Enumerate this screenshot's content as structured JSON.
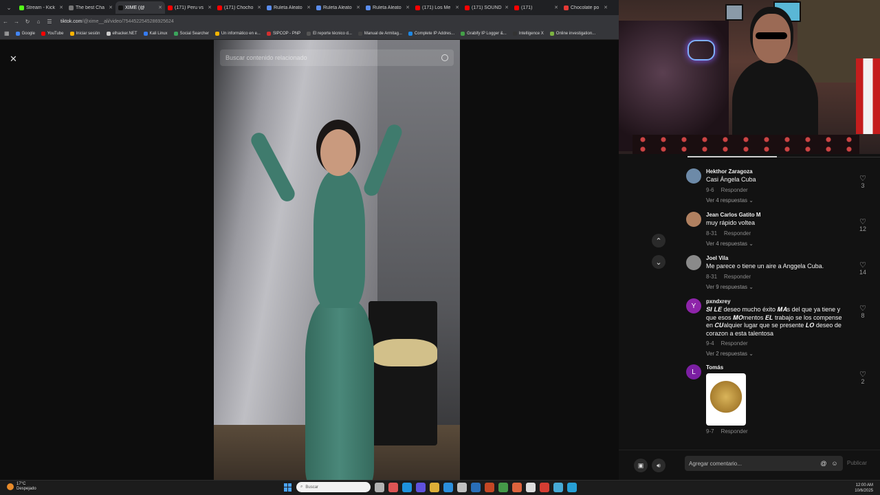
{
  "browser": {
    "tabs": [
      {
        "title": "Stream - Kick",
        "color": "#53fc18",
        "active": false
      },
      {
        "title": "The best Cha",
        "color": "#777777",
        "active": false
      },
      {
        "title": "XIME (@",
        "color": "#111111",
        "active": true
      },
      {
        "title": "(171) Peru vs",
        "color": "#ff0000",
        "active": false
      },
      {
        "title": "(171) Chocho",
        "color": "#ff0000",
        "active": false
      },
      {
        "title": "Ruleta Aleato",
        "color": "#5a8dee",
        "active": false
      },
      {
        "title": "Ruleta Aleato",
        "color": "#5a8dee",
        "active": false
      },
      {
        "title": "Ruleta Aleato",
        "color": "#5a8dee",
        "active": false
      },
      {
        "title": "(171) Los Me",
        "color": "#ff0000",
        "active": false
      },
      {
        "title": "(171) SOUND",
        "color": "#ff0000",
        "active": false
      },
      {
        "title": "(171)",
        "color": "#ff0000",
        "active": false
      },
      {
        "title": "Chocolate po",
        "color": "#e53935",
        "active": false
      }
    ],
    "url_host": "tiktok.com",
    "url_path": "/@xime__ali/video/7544522545286925624",
    "bookmarks": [
      {
        "label": "Google",
        "color": "#4285f4"
      },
      {
        "label": "YouTube",
        "color": "#ff0000"
      },
      {
        "label": "Iniciar sesión",
        "color": "#ffb300"
      },
      {
        "label": "elhacker.NET",
        "color": "#cccccc"
      },
      {
        "label": "Kali Linux",
        "color": "#367bf0"
      },
      {
        "label": "Social Searcher",
        "color": "#3ba55c"
      },
      {
        "label": "Un informático en e...",
        "color": "#f4b400"
      },
      {
        "label": "SIPCOP - PNP",
        "color": "#d32f2f"
      },
      {
        "label": "El reporte técnico d...",
        "color": "#555555"
      },
      {
        "label": "Manual de Armitag...",
        "color": "#444444"
      },
      {
        "label": "Complete IP Addres...",
        "color": "#1e88e5"
      },
      {
        "label": "Grabify IP Logger &...",
        "color": "#43a047"
      },
      {
        "label": "Intelligence X",
        "color": "#333333"
      },
      {
        "label": "Online investigation...",
        "color": "#7cb342"
      }
    ]
  },
  "video": {
    "search_placeholder": "Buscar contenido relacionado"
  },
  "comments": [
    {
      "user": "Hekthor Zaragoza",
      "text": "Casi Ángela Cuba",
      "date": "9-6",
      "reply": "Responder",
      "more": "Ver 4 respuestas",
      "likes": "3",
      "avatar_letter": "",
      "avatar_color": "#6d8aa8"
    },
    {
      "user": "Jean Carlos Gatito M",
      "text": "muy rápido voltea",
      "date": "8-31",
      "reply": "Responder",
      "more": "Ver 4 respuestas",
      "likes": "12",
      "avatar_letter": "",
      "avatar_color": "#b08060"
    },
    {
      "user": "Joel Vila",
      "text": "Me parece o tiene un aire a Anggela Cuba.",
      "date": "8-31",
      "reply": "Responder",
      "more": "Ver 9 respuestas",
      "likes": "14",
      "avatar_letter": "",
      "avatar_color": "#8a8a8a"
    },
    {
      "user": "pxndxrey",
      "text": "𝑺𝑰 𝑳𝑬 deseo mucho éxito 𝑴𝑨s del que ya tiene y que esos 𝑴𝑶mentos 𝑬𝑳 trabajo se los compense en 𝑪𝑼alquier lugar que se presente 𝑳𝑶 deseo de corazon a esta talentosa",
      "date": "9-4",
      "reply": "Responder",
      "more": "Ver 2 respuestas",
      "likes": "8",
      "avatar_letter": "Y",
      "avatar_color": "#8e24aa"
    },
    {
      "user": "Tomás",
      "text": "",
      "date": "9-7",
      "reply": "Responder",
      "more": "",
      "likes": "2",
      "avatar_letter": "L",
      "avatar_color": "#7b1fa2"
    }
  ],
  "composer": {
    "placeholder": "Agregar comentario...",
    "publish_label": "Publicar"
  },
  "taskbar": {
    "temp": "17°C",
    "weather": "Despejado",
    "search_label": "Buscar",
    "time": "12:00 AM",
    "date": "10/6/2025",
    "apps": [
      "#cccccc",
      "#ff5e5e",
      "#1ea7ff",
      "#6b5bff",
      "#ffc83d",
      "#2ea3ff",
      "#dddddd",
      "#2b7cd3",
      "#e34f26",
      "#4caf50",
      "#ff7043",
      "#ffffff",
      "#f44336",
      "#4fc3f7",
      "#29b6f6"
    ]
  }
}
